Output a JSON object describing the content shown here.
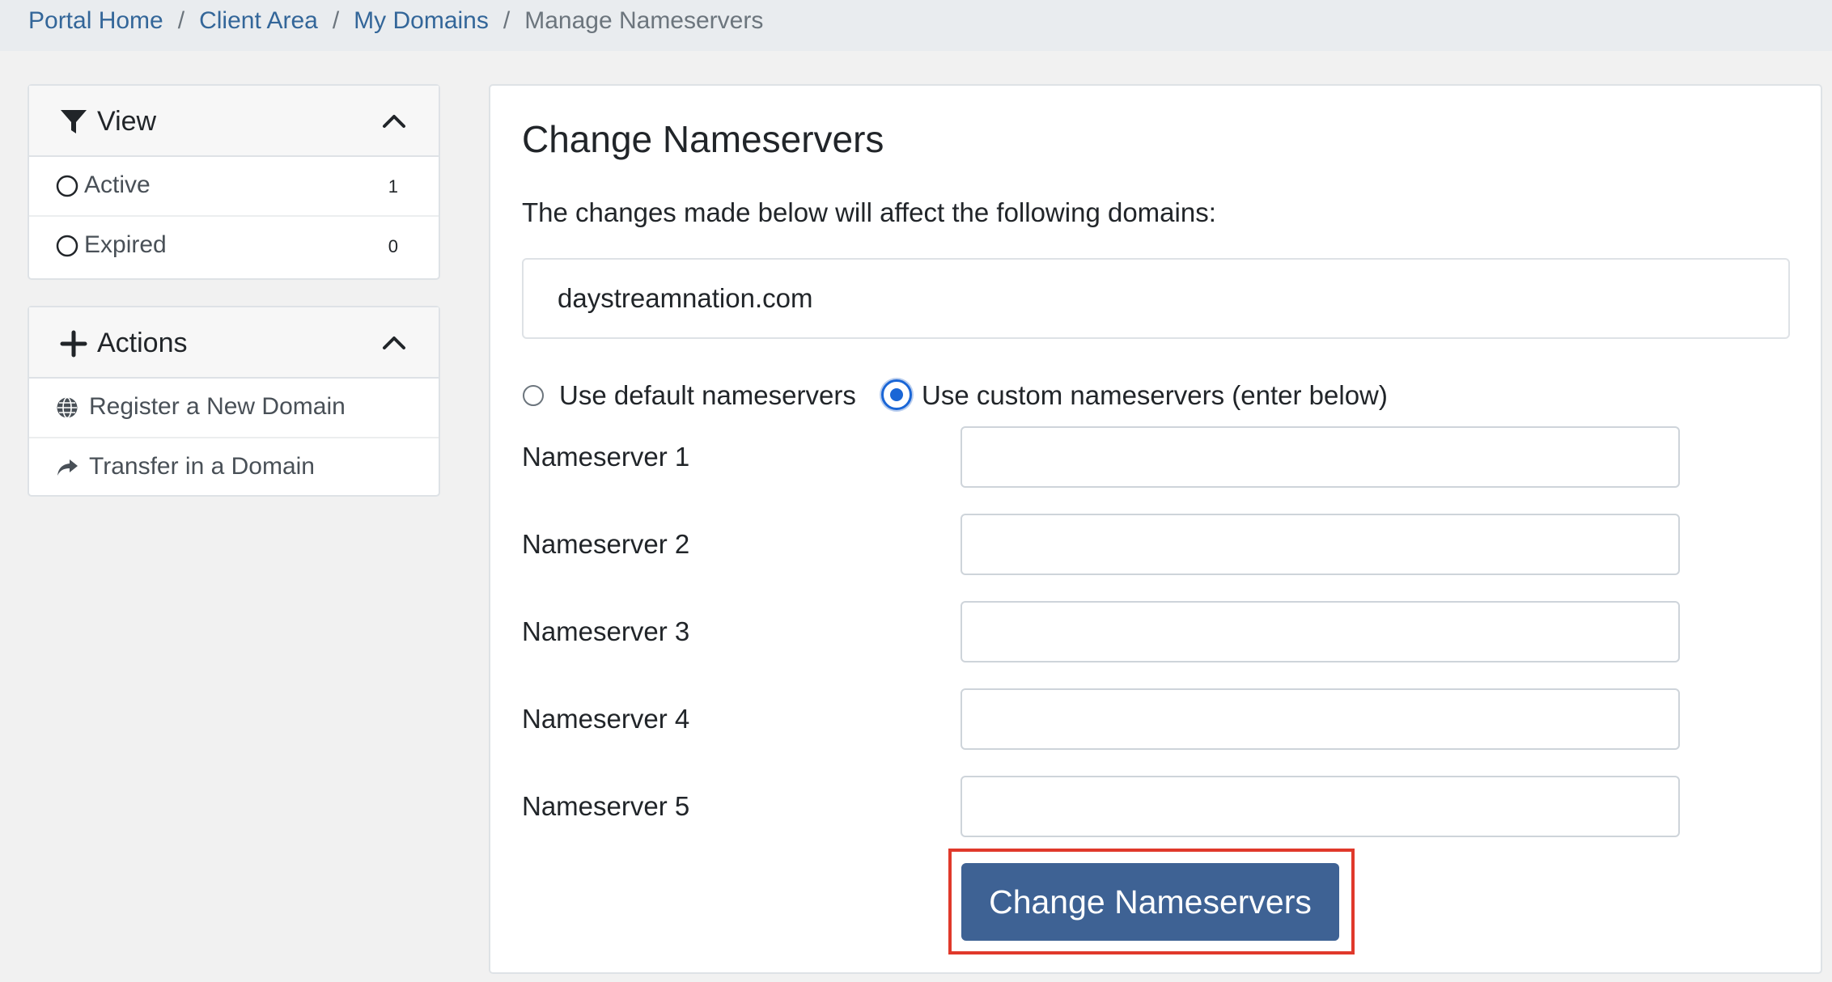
{
  "breadcrumb": {
    "items": [
      "Portal Home",
      "Client Area",
      "My Domains"
    ],
    "separator": "/",
    "current": "Manage Nameservers"
  },
  "sidebar": {
    "view": {
      "title": "View",
      "icon": "filter-icon",
      "items": [
        {
          "label": "Active",
          "count": "1",
          "icon": "radio-circle-icon"
        },
        {
          "label": "Expired",
          "count": "0",
          "icon": "radio-circle-icon"
        }
      ]
    },
    "actions": {
      "title": "Actions",
      "icon": "plus-icon",
      "items": [
        {
          "label": "Register a New Domain",
          "icon": "globe-icon"
        },
        {
          "label": "Transfer in a Domain",
          "icon": "share-arrow-icon"
        }
      ]
    }
  },
  "main": {
    "title": "Change Nameservers",
    "description": "The changes made below will affect the following domains:",
    "domains": [
      "daystreamnation.com"
    ],
    "options": {
      "default_label": "Use default nameservers",
      "custom_label": "Use custom nameservers (enter below)",
      "selected": "custom"
    },
    "nameservers": [
      {
        "label": "Nameserver 1",
        "value": ""
      },
      {
        "label": "Nameserver 2",
        "value": ""
      },
      {
        "label": "Nameserver 3",
        "value": ""
      },
      {
        "label": "Nameserver 4",
        "value": ""
      },
      {
        "label": "Nameserver 5",
        "value": ""
      }
    ],
    "submit_label": "Change Nameservers"
  },
  "colors": {
    "link": "#336699",
    "primary_button": "#3e6294",
    "highlight_outline": "#e0392b",
    "radio_selected": "#1a66d6"
  }
}
